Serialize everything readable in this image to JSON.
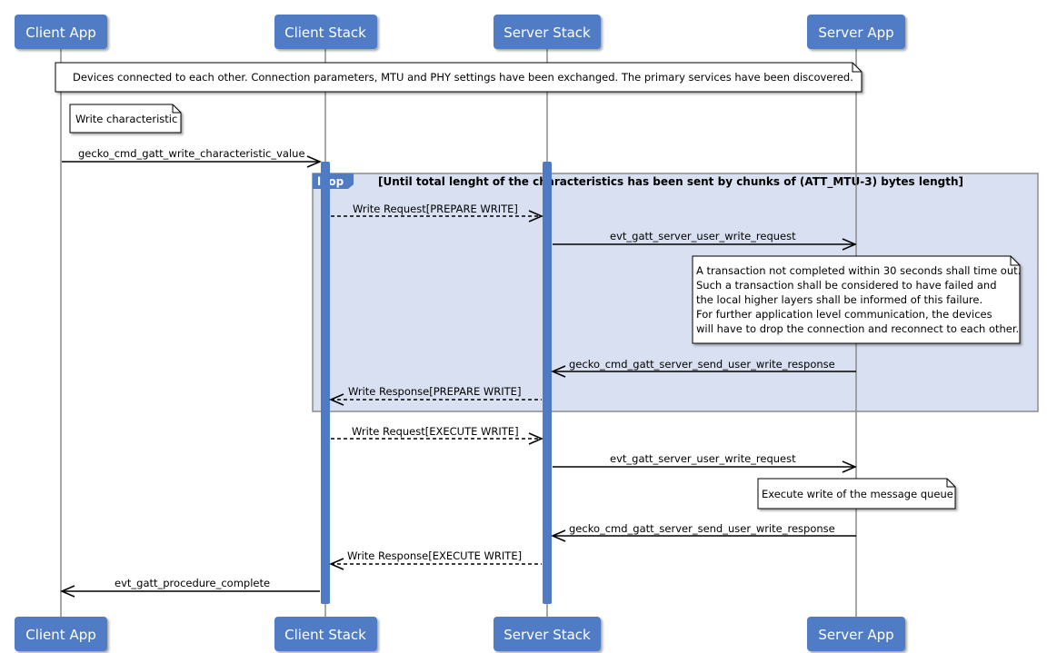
{
  "diagram_type": "sequence",
  "colors": {
    "participant_fill": "#4f7bc4",
    "participant_text": "#ffffff",
    "lifeline": "#8c8c8c",
    "activation": "#4f7bc4",
    "loop_fill": "#d6def0",
    "loop_border": "#8c8c8c",
    "note_fill": "#ffffff",
    "arrow": "#000000"
  },
  "participants": [
    {
      "id": "client_app",
      "label": "Client App"
    },
    {
      "id": "client_stack",
      "label": "Client Stack"
    },
    {
      "id": "server_stack",
      "label": "Server Stack"
    },
    {
      "id": "server_app",
      "label": "Server App"
    }
  ],
  "notes": [
    {
      "id": "connected",
      "text": [
        "Devices connected to each other. Connection parameters, MTU and PHY settings have been exchanged. The primary services have been discovered."
      ]
    },
    {
      "id": "write-char",
      "text": [
        "Write characteristic"
      ]
    },
    {
      "id": "timeout",
      "text": [
        "A transaction not completed within 30 seconds shall time out.",
        "Such a transaction shall be considered to have failed and",
        "the local higher layers shall be informed of this failure.",
        "For further application level communication, the devices",
        "will have to drop the connection and reconnect to each other."
      ]
    },
    {
      "id": "execute-queue",
      "text": [
        "Execute write of the message queue"
      ]
    }
  ],
  "loop": {
    "tag": "loop",
    "condition": "[Until total lenght of the characteristics has been sent by chunks of (ATT_MTU-3) bytes length]"
  },
  "messages": [
    {
      "from": "client_app",
      "to": "client_stack",
      "label": "gecko_cmd_gatt_write_characteristic_value",
      "style": "solid"
    },
    {
      "from": "client_stack",
      "to": "server_stack",
      "label": "Write Request[PREPARE WRITE]",
      "style": "dashed"
    },
    {
      "from": "server_stack",
      "to": "server_app",
      "label": "evt_gatt_server_user_write_request",
      "style": "solid"
    },
    {
      "from": "server_app",
      "to": "server_stack",
      "label": "gecko_cmd_gatt_server_send_user_write_response",
      "style": "solid"
    },
    {
      "from": "server_stack",
      "to": "client_stack",
      "label": "Write Response[PREPARE WRITE]",
      "style": "dashed"
    },
    {
      "from": "client_stack",
      "to": "server_stack",
      "label": "Write Request[EXECUTE WRITE]",
      "style": "dashed"
    },
    {
      "from": "server_stack",
      "to": "server_app",
      "label": "evt_gatt_server_user_write_request",
      "style": "solid"
    },
    {
      "from": "server_app",
      "to": "server_stack",
      "label": "gecko_cmd_gatt_server_send_user_write_response",
      "style": "solid"
    },
    {
      "from": "server_stack",
      "to": "client_stack",
      "label": "Write Response[EXECUTE WRITE]",
      "style": "dashed"
    },
    {
      "from": "client_stack",
      "to": "client_app",
      "label": "evt_gatt_procedure_complete",
      "style": "solid"
    }
  ]
}
